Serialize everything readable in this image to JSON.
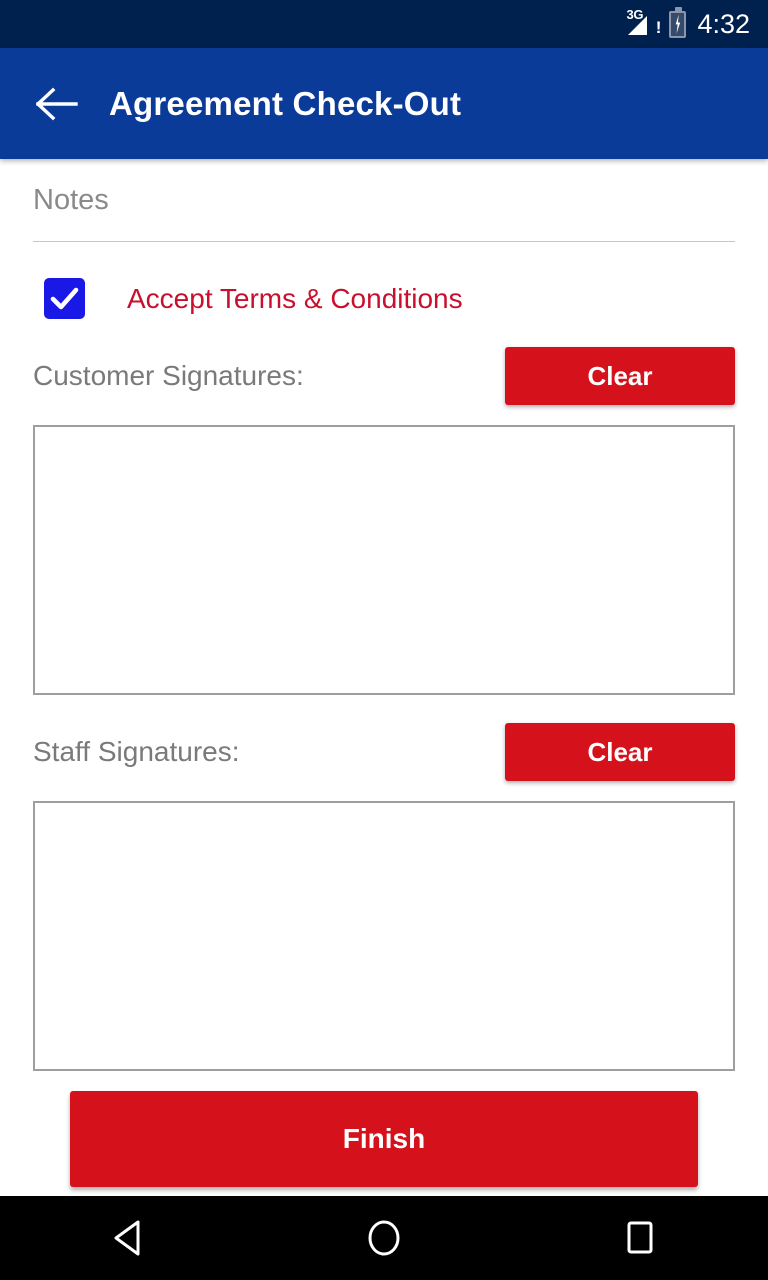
{
  "status_bar": {
    "network_label": "3G",
    "network_alert": "!",
    "time": "4:32",
    "signal_icon": "signal-bars-icon",
    "battery_icon": "battery-charging-icon",
    "background_color": "#00214e"
  },
  "app_bar": {
    "back_icon": "arrow-left-icon",
    "title": "Agreement Check-Out",
    "background_color": "#0b3b98",
    "title_color": "#ffffff"
  },
  "form": {
    "notes": {
      "value": "",
      "placeholder": "Notes"
    },
    "terms": {
      "label": "Accept Terms & Conditions",
      "checked": true,
      "checkbox_color": "#1a18e6",
      "label_color": "#c8102e",
      "check_icon": "checkmark-icon"
    },
    "customer_signature": {
      "label": "Customer Signatures:",
      "clear_label": "Clear",
      "value": ""
    },
    "staff_signature": {
      "label": "Staff Signatures:",
      "clear_label": "Clear",
      "value": ""
    },
    "finish_label": "Finish",
    "accent_red": "#d5121b",
    "label_color": "#7a7a7a"
  },
  "nav_bar": {
    "back_icon": "triangle-back-icon",
    "home_icon": "circle-home-icon",
    "recents_icon": "square-recents-icon",
    "background_color": "#000000"
  }
}
